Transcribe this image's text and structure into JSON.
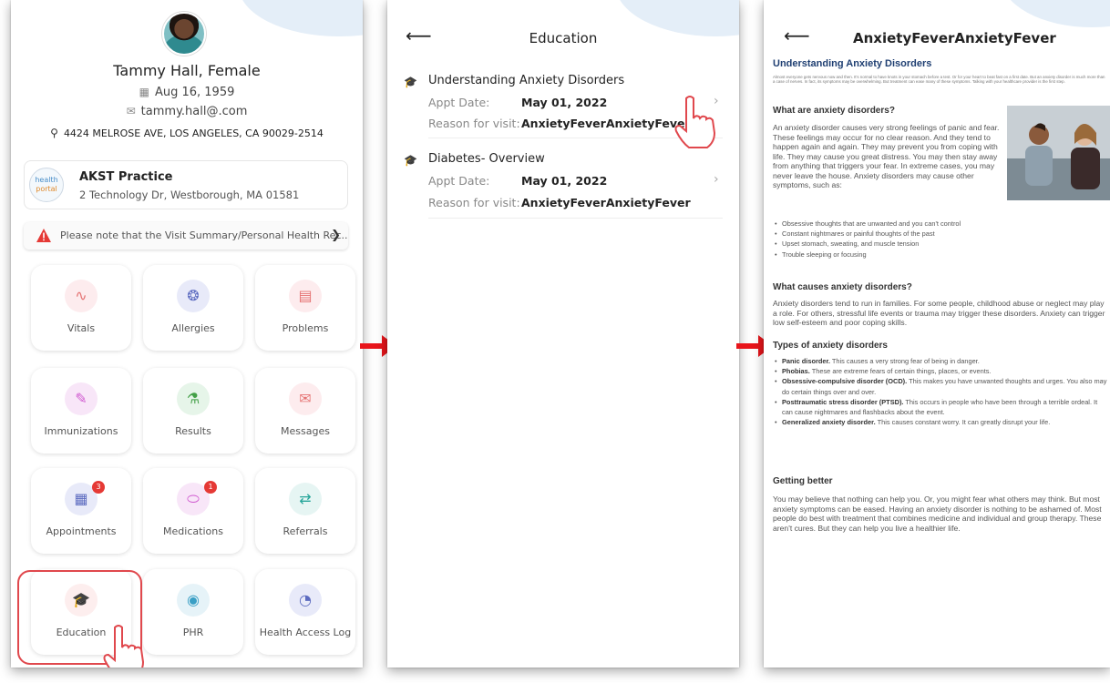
{
  "patient": {
    "name_gender": "Tammy Hall, Female",
    "dob": "Aug 16, 1959",
    "email": "tammy.hall@.com",
    "address": "4424 MELROSE AVE, LOS ANGELES, CA 90029-2514"
  },
  "practice": {
    "logo_text_top": "health",
    "logo_text_bottom": "portal",
    "name": "AKST Practice",
    "address": "2 Technology Dr, Westborough, MA 01581"
  },
  "notice": {
    "text": "Please note that the Visit Summary/Personal Health Rec..."
  },
  "tiles": [
    {
      "label": "Vitals",
      "icon": "heartbeat-icon",
      "color": "#fdecee",
      "glyph": "∿",
      "glyph_color": "#e57373"
    },
    {
      "label": "Allergies",
      "icon": "allergy-icon",
      "color": "#e8eaf9",
      "glyph": "❂",
      "glyph_color": "#5c6bc0"
    },
    {
      "label": "Problems",
      "icon": "clipboard-icon",
      "color": "#fdecee",
      "glyph": "▤",
      "glyph_color": "#e57373"
    },
    {
      "label": "Immunizations",
      "icon": "syringe-icon",
      "color": "#f8e6f8",
      "glyph": "✎",
      "glyph_color": "#d05ad0"
    },
    {
      "label": "Results",
      "icon": "flask-icon",
      "color": "#e6f5e9",
      "glyph": "⚗",
      "glyph_color": "#43a047"
    },
    {
      "label": "Messages",
      "icon": "envelope-icon",
      "color": "#fdecee",
      "glyph": "✉",
      "glyph_color": "#e57373"
    },
    {
      "label": "Appointments",
      "icon": "calendar-icon",
      "color": "#e8eaf9",
      "glyph": "▦",
      "glyph_color": "#5c6bc0",
      "badge": "3"
    },
    {
      "label": "Medications",
      "icon": "pill-icon",
      "color": "#f8e6f8",
      "glyph": "⬭",
      "glyph_color": "#d05ad0",
      "badge": "1"
    },
    {
      "label": "Referrals",
      "icon": "referral-icon",
      "color": "#e6f5f3",
      "glyph": "⇄",
      "glyph_color": "#26a69a"
    },
    {
      "label": "Education",
      "icon": "graduation-cap-icon",
      "color": "#fdeeee",
      "glyph": "🎓",
      "glyph_color": "#e57373"
    },
    {
      "label": "PHR",
      "icon": "phr-icon",
      "color": "#e6f3f8",
      "glyph": "◉",
      "glyph_color": "#3a9fc5"
    },
    {
      "label": "Health Access Log",
      "icon": "access-log-icon",
      "color": "#e8eaf9",
      "glyph": "◔",
      "glyph_color": "#5c6bc0"
    }
  ],
  "education": {
    "title": "Education",
    "appt_label": "Appt Date:",
    "reason_label": "Reason for visit:",
    "items": [
      {
        "title": "Understanding Anxiety Disorders",
        "date": "May 01, 2022",
        "reason": "AnxietyFeverAnxietyFever"
      },
      {
        "title": "Diabetes- Overview",
        "date": "May 01, 2022",
        "reason": "AnxietyFeverAnxietyFever"
      }
    ]
  },
  "article": {
    "title": "AnxietyFeverAnxietyFever",
    "heading": "Understanding Anxiety Disorders",
    "fine_print": "Almost everyone gets nervous now and then. It's normal to have knots in your stomach before a test. Or for your heart to beat fast on a first date. But an anxiety disorder is much more than a case of nerves. In fact, its symptoms may be overwhelming. But treatment can ease many of these symptoms. Talking with your healthcare provider is the first step.",
    "s1_heading": "What are anxiety disorders?",
    "s1_text": "An anxiety disorder causes very strong feelings of panic and fear. These feelings may occur for no clear reason. And they tend to happen again and again. They may prevent you from coping with life. They may cause you great distress. You may then stay away from anything that triggers your fear. In extreme cases, you may never leave the house. Anxiety disorders may cause other symptoms, such as:",
    "s1_bullets": [
      "Obsessive thoughts that are unwanted and you can't control",
      "Constant nightmares or painful thoughts of the past",
      "Upset stomach, sweating, and muscle tension",
      "Trouble sleeping or focusing"
    ],
    "s2_heading": "What causes anxiety disorders?",
    "s2_text": "Anxiety disorders tend to run in families. For some people, childhood abuse or neglect may play a role. For others, stressful life events or trauma may trigger these disorders. Anxiety can trigger low self-esteem and poor coping skills.",
    "s3_heading": "Types of anxiety disorders",
    "s3_bullets": [
      {
        "b": "Panic disorder.",
        "t": " This causes a very strong fear of being in danger."
      },
      {
        "b": "Phobias.",
        "t": " These are extreme fears of certain things, places, or events."
      },
      {
        "b": "Obsessive-compulsive disorder (OCD).",
        "t": " This makes you have unwanted thoughts and urges. You also may do certain things over and over."
      },
      {
        "b": "Posttraumatic stress disorder (PTSD).",
        "t": " This occurs in people who have been through a terrible ordeal. It can cause nightmares and flashbacks about the event."
      },
      {
        "b": "Generalized anxiety disorder.",
        "t": " This causes constant worry. It can greatly disrupt your life."
      }
    ],
    "s4_heading": "Getting better",
    "s4_text": "You may believe that nothing can help you. Or, you might fear what others may think. But most anxiety symptoms can be eased. Having an anxiety disorder is nothing to be ashamed of. Most people do best with treatment that combines medicine and individual and group therapy. These aren't cures. But they can help you live a healthier life."
  },
  "colors": {
    "accent_red": "#e0484d",
    "heading_blue": "#1f3f72"
  }
}
